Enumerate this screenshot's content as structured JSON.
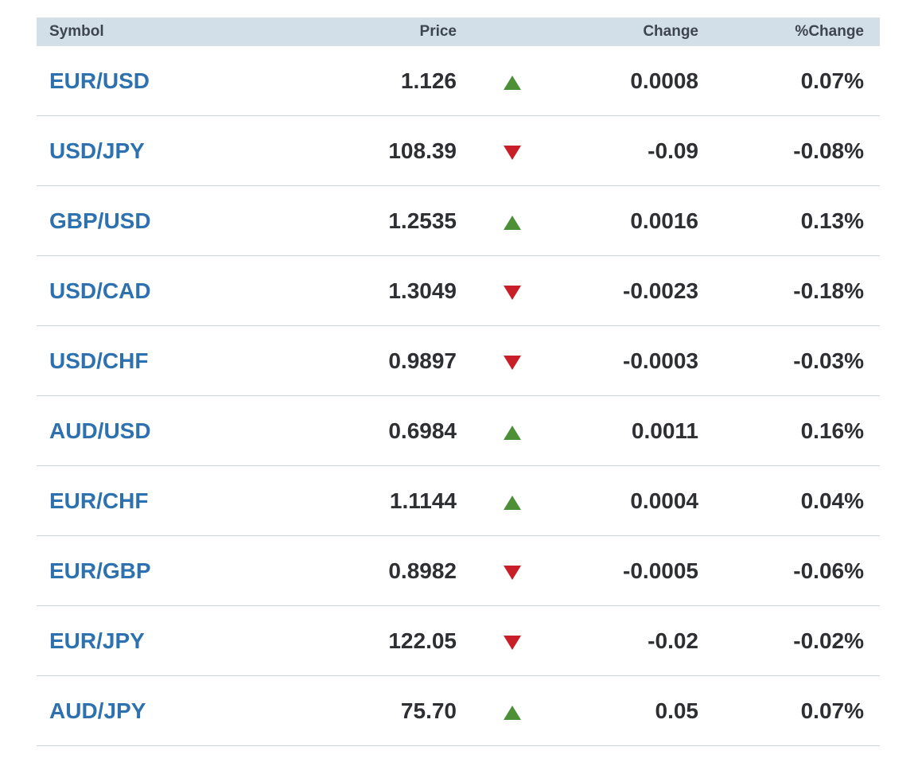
{
  "header": {
    "symbol": "Symbol",
    "price": "Price",
    "change": "Change",
    "pct_change": "%Change"
  },
  "colors": {
    "symbol_link": "#2d71ae",
    "up": "#4d8f36",
    "down": "#c81e28",
    "header_bg": "#d3dfe8"
  },
  "rows": [
    {
      "symbol": "EUR/USD",
      "price": "1.126",
      "direction": "up",
      "change": "0.0008",
      "pct": "0.07%"
    },
    {
      "symbol": "USD/JPY",
      "price": "108.39",
      "direction": "down",
      "change": "-0.09",
      "pct": "-0.08%"
    },
    {
      "symbol": "GBP/USD",
      "price": "1.2535",
      "direction": "up",
      "change": "0.0016",
      "pct": "0.13%"
    },
    {
      "symbol": "USD/CAD",
      "price": "1.3049",
      "direction": "down",
      "change": "-0.0023",
      "pct": "-0.18%"
    },
    {
      "symbol": "USD/CHF",
      "price": "0.9897",
      "direction": "down",
      "change": "-0.0003",
      "pct": "-0.03%"
    },
    {
      "symbol": "AUD/USD",
      "price": "0.6984",
      "direction": "up",
      "change": "0.0011",
      "pct": "0.16%"
    },
    {
      "symbol": "EUR/CHF",
      "price": "1.1144",
      "direction": "up",
      "change": "0.0004",
      "pct": "0.04%"
    },
    {
      "symbol": "EUR/GBP",
      "price": "0.8982",
      "direction": "down",
      "change": "-0.0005",
      "pct": "-0.06%"
    },
    {
      "symbol": "EUR/JPY",
      "price": "122.05",
      "direction": "down",
      "change": "-0.02",
      "pct": "-0.02%"
    },
    {
      "symbol": "AUD/JPY",
      "price": "75.70",
      "direction": "up",
      "change": "0.05",
      "pct": "0.07%"
    }
  ]
}
